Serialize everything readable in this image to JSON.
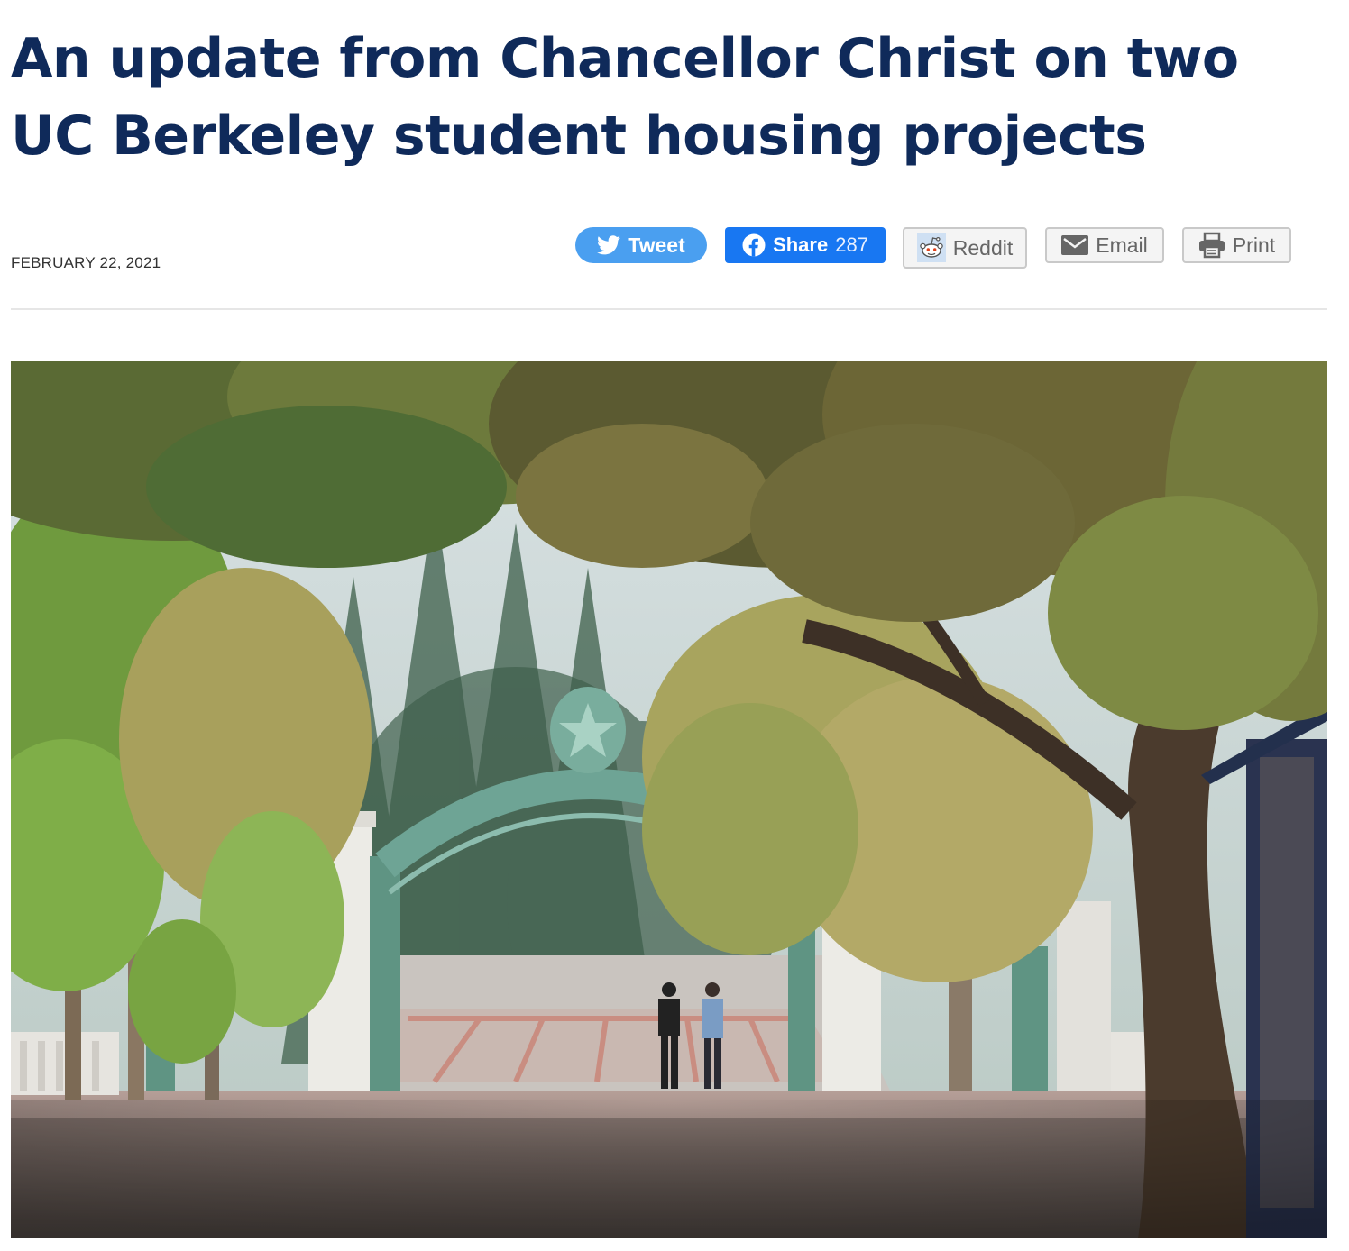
{
  "article": {
    "title": "An update from Chancellor Christ on two UC Berkeley student housing projects",
    "date": "FEBRUARY 22, 2021"
  },
  "share": {
    "tweet_label": "Tweet",
    "share_label": "Share",
    "share_count": "287",
    "reddit_label": "Reddit",
    "email_label": "Email",
    "print_label": "Print",
    "icons": [
      "twitter-icon",
      "facebook-icon",
      "reddit-icon",
      "email-icon",
      "print-icon"
    ],
    "colors": {
      "tweet": "#4a9ff0",
      "facebook": "#1877f2",
      "neutral": "#f4f4f4"
    }
  },
  "theme": {
    "title_color": "#0f2a5a"
  }
}
